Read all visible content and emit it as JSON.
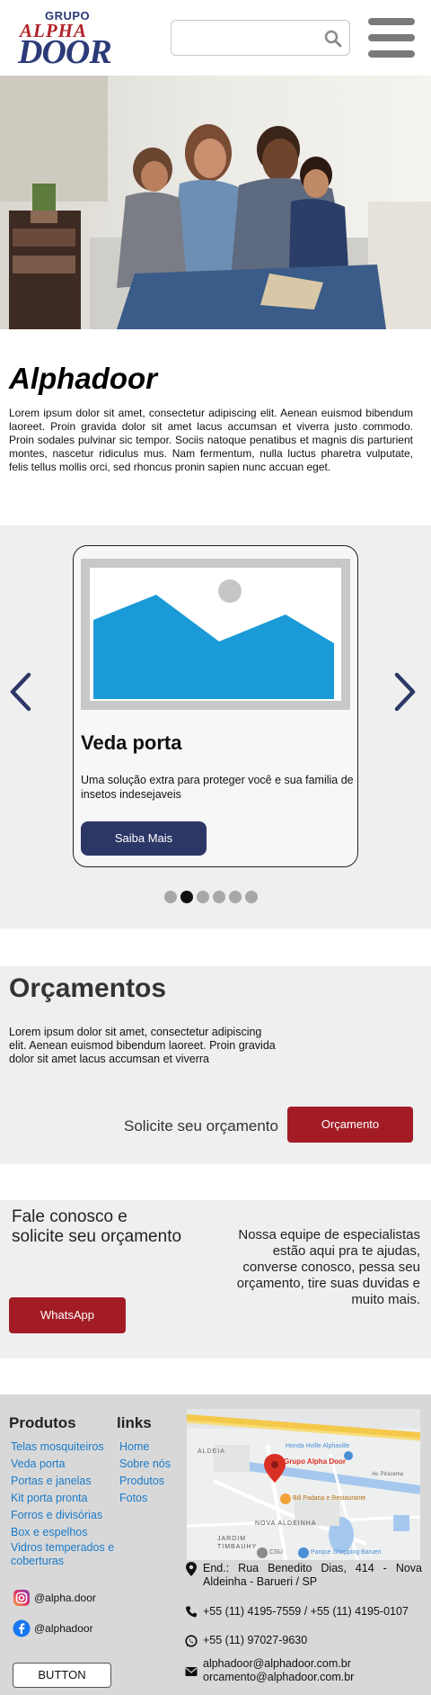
{
  "header": {
    "logo": {
      "grupo": "GRUPO",
      "alpha": "ALPHA",
      "door": "DOOR"
    },
    "search": {
      "placeholder": "",
      "value": ""
    },
    "colors": {
      "brand_red": "#a31c25",
      "brand_navy": "#2c3766"
    }
  },
  "about": {
    "title": "Alphadoor",
    "text": "Lorem ipsum dolor sit amet, consectetur adipiscing elit. Aenean euismod bibendum laoreet. Proin gravida dolor sit amet lacus accumsan et viverra justo commodo. Proin sodales pulvinar sic tempor. Sociis natoque penatibus et magnis dis parturient montes, nascetur ridiculus mus. Nam fermentum, nulla luctus pharetra vulputate, felis tellus mollis orci, sed rhoncus pronin sapien nunc accuan eget."
  },
  "carousel": {
    "card_title": "Veda porta",
    "card_text": "Uma solução extra para proteger você e sua familia de insetos indesejaveis",
    "card_button": "Saiba Mais",
    "slide_count": 6,
    "active_slide": 2
  },
  "orcamentos": {
    "title": "Orçamentos",
    "text": "Lorem ipsum dolor sit amet, consectetur adipiscing elit. Aenean euismod bibendum laoreet. Proin gravida dolor sit amet lacus accumsan et viverra",
    "cta_text": "Solicite seu orçamento",
    "button": "Orçamento"
  },
  "fale": {
    "title": "Fale conosco e solicite seu orçamento",
    "text": "Nossa equipe de especialistas estão aqui pra te ajudas, converse conosco, pessa seu orçamento, tire suas duvidas e muito mais.",
    "button": "WhatsApp"
  },
  "footer": {
    "produtos_title": "Produtos",
    "produtos": [
      "Telas mosquiteiros",
      "Veda porta",
      "Portas e janelas",
      "Kit porta pronta",
      "Forros e divisórias",
      "Box e espelhos",
      "Vidros temperados e coberturas"
    ],
    "links_title": "links",
    "links": [
      "Home",
      "Sobre nós",
      "Produtos",
      "Fotos"
    ],
    "map": {
      "pin_label": "Grupo Alpha Door",
      "labels": [
        "Honda Hville Alphaville",
        "ALDEIA",
        "Bill Padaria e Restaurante",
        "NOVA ALDEINHA",
        "JARDIM TIMBAUHY",
        "Parque Shopping Barueri",
        "CSU",
        "Av. Piracema"
      ]
    },
    "instagram": "@alpha.door",
    "facebook": "@alphadoor",
    "address": "End.: Rua Benedito Dias, 414 - Nova Aldeinha - Barueri / SP",
    "phones": "+55 (11) 4195-7559 / +55 (11) 4195-0107",
    "whatsapp": "+55 (11) 97027-9630",
    "email1": "alphadoor@alphadoor.com.br",
    "email2": "orcamento@alphadoor.com.br",
    "button": "BUTTON"
  }
}
